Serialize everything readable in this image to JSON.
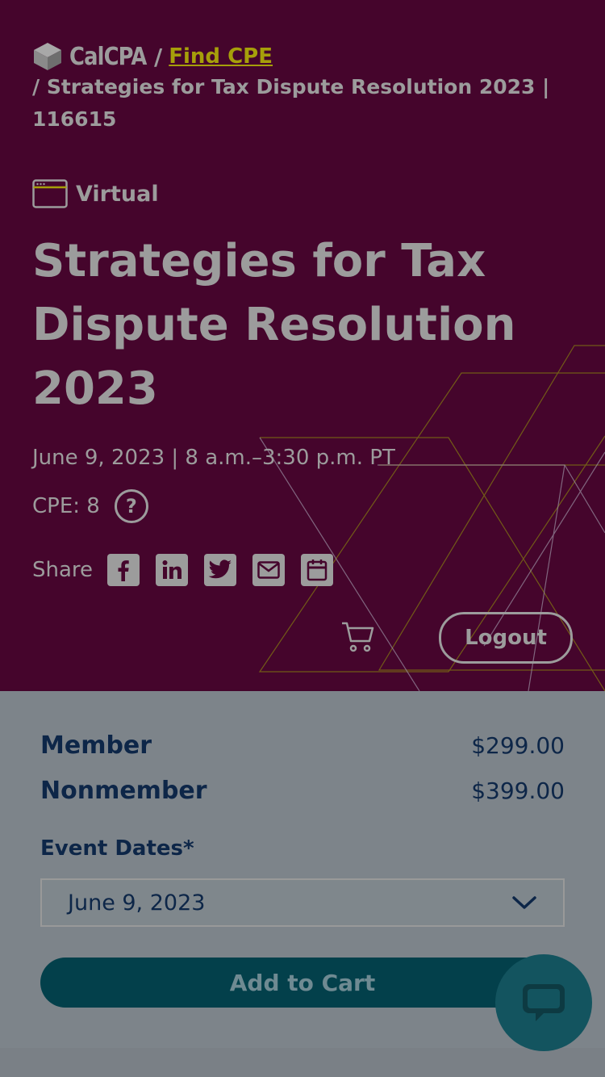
{
  "breadcrumb": {
    "brand": "CalCPA",
    "separator": "/",
    "link": "Find CPE",
    "current": "/ Strategies for Tax Dispute Resolution 2023 | 116615"
  },
  "event": {
    "format_icon": "browser-window-icon",
    "format": "Virtual",
    "title": "Strategies for Tax Dispute Resolution 2023",
    "date_time": "June 9, 2023 | 8 a.m.–3:30 p.m. PT",
    "cpe": "CPE: 8",
    "help_glyph": "?"
  },
  "share": {
    "label": "Share",
    "icons": [
      "facebook-icon",
      "linkedin-icon",
      "twitter-icon",
      "email-icon",
      "calendar-icon"
    ]
  },
  "header_actions": {
    "cart_icon": "cart-icon",
    "logout": "Logout"
  },
  "pricing": {
    "member_label": "Member",
    "member_price": "$299.00",
    "nonmember_label": "Nonmember",
    "nonmember_price": "$399.00"
  },
  "event_dates": {
    "label": "Event Dates*",
    "selected": "June 9, 2023"
  },
  "add_to_cart": "Add to Cart",
  "chat_icon": "chat-icon",
  "colors": {
    "hero_bg": "#45052c",
    "link_accent": "#a69f0a",
    "primary_text": "#0d2648",
    "cart_button": "#03404b",
    "chat_button": "#13545f"
  }
}
